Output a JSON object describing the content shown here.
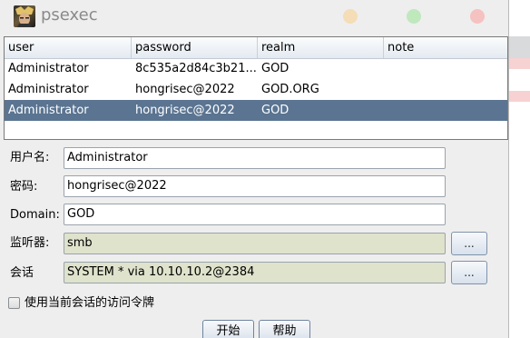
{
  "window": {
    "title": "psexec",
    "buttons": [
      "minimize-icon",
      "maximize-icon",
      "close-icon"
    ],
    "colors": {
      "minimize": "#f4ddb7",
      "maximize": "#bfe8bd",
      "close": "#f6c1c1"
    }
  },
  "table": {
    "columns": [
      "user",
      "password",
      "realm",
      "note"
    ],
    "rows": [
      {
        "user": "Administrator",
        "password": "8c535a2d84c3b21...",
        "realm": "GOD",
        "note": ""
      },
      {
        "user": "Administrator",
        "password": "hongrisec@2022",
        "realm": "GOD.ORG",
        "note": ""
      },
      {
        "user": "Administrator",
        "password": "hongrisec@2022",
        "realm": "GOD",
        "note": ""
      }
    ],
    "selected_row": 2,
    "selected_color": "#5a7491"
  },
  "form": {
    "username_label": "用户名:",
    "username_value": "Administrator",
    "password_label": "密码:",
    "password_value": "hongrisec@2022",
    "domain_label": "Domain:",
    "domain_value": "GOD",
    "listener_label": "监听器:",
    "listener_value": "smb",
    "listener_browse": "...",
    "session_label": "会话",
    "session_value": "SYSTEM * via  10.10.10.2@2384",
    "session_browse": "...",
    "use_token_label": "使用当前会话的访问令牌",
    "use_token_checked": false
  },
  "actions": {
    "start": "开始",
    "help": "帮助"
  }
}
